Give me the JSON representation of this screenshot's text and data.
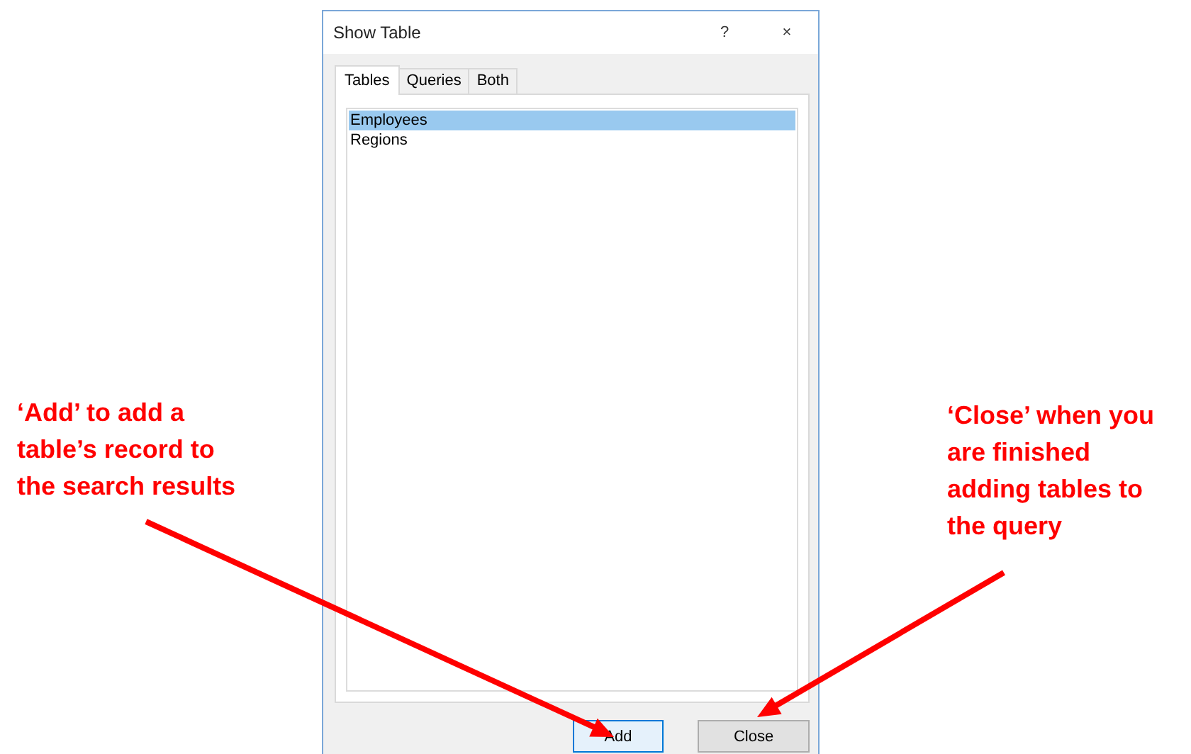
{
  "window": {
    "title": "Show Table",
    "help": "?",
    "close": "×"
  },
  "tabs": [
    {
      "label": "Tables",
      "selected": true
    },
    {
      "label": "Queries",
      "selected": false
    },
    {
      "label": "Both",
      "selected": false
    }
  ],
  "list": [
    {
      "label": "Employees",
      "selected": true
    },
    {
      "label": "Regions",
      "selected": false
    }
  ],
  "buttons": [
    {
      "label": "Add",
      "default": true
    },
    {
      "label": "Close",
      "default": false
    }
  ],
  "annotations": [
    {
      "lines": [
        "‘Add’ to add a",
        "table’s record to",
        "the search results"
      ]
    },
    {
      "lines": [
        "‘Close’ when you",
        "are finished",
        "adding tables to",
        "the query"
      ]
    }
  ]
}
